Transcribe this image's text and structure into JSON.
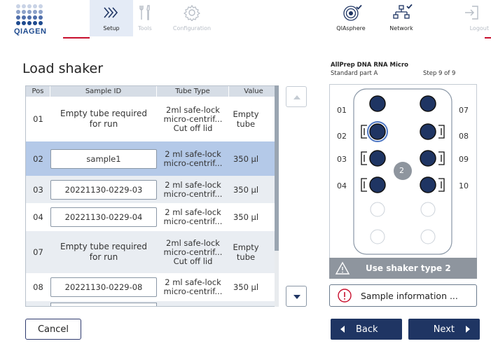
{
  "brand": {
    "logo_text": "QIAGEN"
  },
  "nav": {
    "setup": "Setup",
    "tools": "Tools",
    "configuration": "Configuration",
    "qiasphere": "QIAsphere",
    "network": "Network",
    "logout": "Logout"
  },
  "page_title": "Load shaker",
  "table": {
    "headers": [
      "Pos",
      "Sample ID",
      "Tube Type",
      "Value"
    ],
    "rows": [
      {
        "pos": "01",
        "sample_id": "Empty tube required for run",
        "tube_type": "2ml safe-lock micro-centrif... Cut off lid",
        "value": "Empty tube"
      },
      {
        "pos": "02",
        "sample_id": "sample1",
        "tube_type": "2 ml safe-lock micro-centrif...",
        "value": "350 µl"
      },
      {
        "pos": "03",
        "sample_id": "20221130-0229-03",
        "tube_type": "2 ml safe-lock micro-centrif...",
        "value": "350 µl"
      },
      {
        "pos": "04",
        "sample_id": "20221130-0229-04",
        "tube_type": "2 ml safe-lock micro-centrif...",
        "value": "350 µl"
      },
      {
        "pos": "07",
        "sample_id": "Empty tube required for run",
        "tube_type": "2ml safe-lock micro-centrif... Cut off lid",
        "value": "Empty tube"
      },
      {
        "pos": "08",
        "sample_id": "20221130-0229-08",
        "tube_type": "2 ml safe-lock micro-centrif...",
        "value": "350 µl"
      }
    ]
  },
  "kit": {
    "name": "AllPrep DNA RNA Micro",
    "part": "Standard part A",
    "step": "Step 9 of 9"
  },
  "shaker": {
    "left_labels": [
      "01",
      "02",
      "03",
      "04"
    ],
    "right_labels": [
      "07",
      "08",
      "09",
      "10"
    ],
    "center_badge": "2"
  },
  "warning": "Use shaker type 2",
  "info_button": "Sample information ...",
  "buttons": {
    "cancel": "Cancel",
    "back": "Back",
    "next": "Next"
  },
  "colors": {
    "primary": "#1f3563",
    "selected_row": "#b4c9e8",
    "logo_red": "#c8102e",
    "logo_blue": "#1f4b8f"
  }
}
